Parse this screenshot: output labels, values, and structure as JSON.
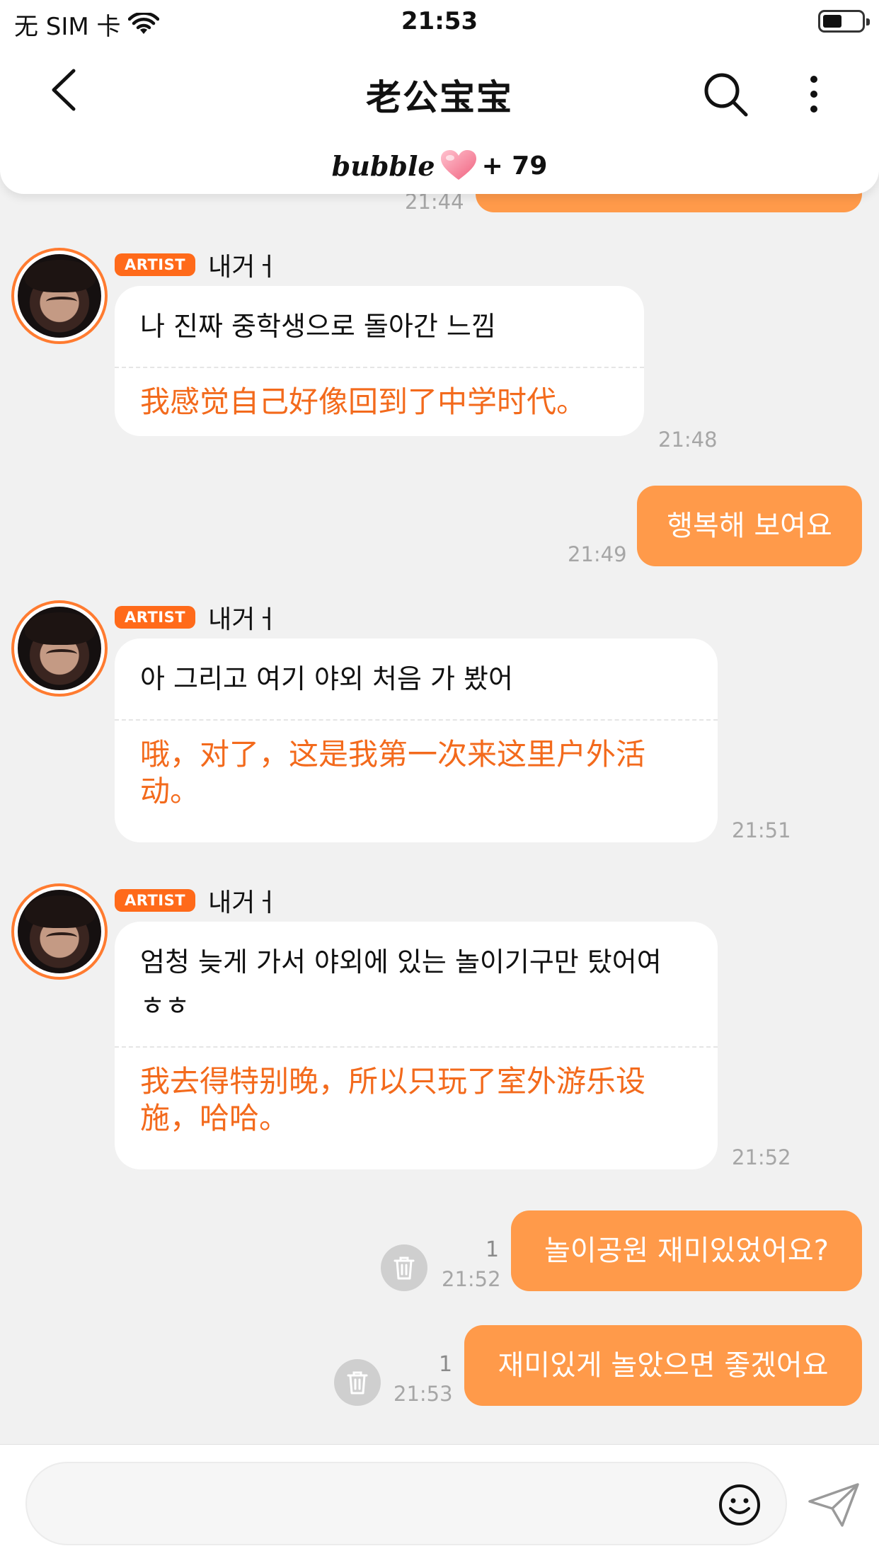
{
  "status_bar": {
    "carrier": "无 SIM 卡",
    "time": "21:53"
  },
  "header": {
    "title": "老公宝宝",
    "bubble_logo": "bubble",
    "bubble_count": "+ 79"
  },
  "top_partial": {
    "time": "21:44"
  },
  "messages": [
    {
      "badge": "ARTIST",
      "sender": "내거ㅓ",
      "original": "나 진짜 중학생으로 돌아간 느낌",
      "translation": "我感觉自己好像回到了中学时代。",
      "time": "21:48"
    },
    {
      "text": "행복해 보여요",
      "time": "21:49"
    },
    {
      "badge": "ARTIST",
      "sender": "내거ㅓ",
      "original": "아 그리고 여기 야외 처음 가 봤어",
      "translation": "哦，对了，这是我第一次来这里户外活动。",
      "time": "21:51"
    },
    {
      "badge": "ARTIST",
      "sender": "내거ㅓ",
      "original": "엄청 늦게 가서 야외에 있는 놀이기구만 탔어여 ㅎㅎ",
      "translation": "我去得特别晚，所以只玩了室外游乐设施，哈哈。",
      "time": "21:52"
    },
    {
      "text": "놀이공원 재미있었어요?",
      "time": "21:52",
      "read_count": "1"
    },
    {
      "text": "재미있게 놀았으면 좋겠어요",
      "time": "21:53",
      "read_count": "1"
    }
  ],
  "input": {
    "placeholder": ""
  },
  "colors": {
    "accent": "#ff9a4a",
    "badge": "#ff6a1a",
    "translation": "#f36a1c",
    "background": "#f1f1f1"
  },
  "icons": {
    "back": "chevron-left-icon",
    "search": "search-icon",
    "more": "more-vertical-icon",
    "heart": "heart-icon",
    "trash": "trash-icon",
    "emoji": "smiley-icon",
    "send": "paper-plane-icon",
    "wifi": "wifi-icon",
    "battery": "battery-icon"
  }
}
